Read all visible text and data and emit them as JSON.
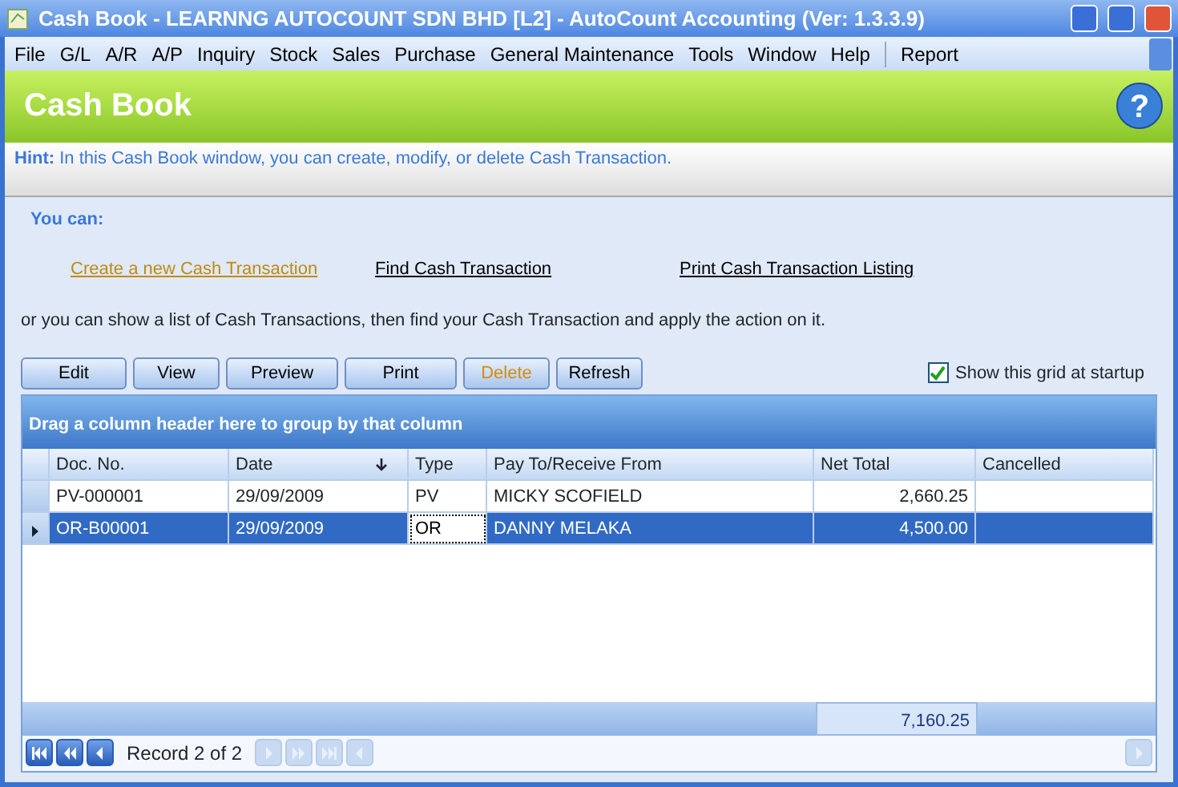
{
  "window": {
    "title": "Cash Book - LEARNNG AUTOCOUNT SDN BHD [L2] - AutoCount Accounting (Ver: 1.3.3.9)"
  },
  "menu": [
    "File",
    "G/L",
    "A/R",
    "A/P",
    "Inquiry",
    "Stock",
    "Sales",
    "Purchase",
    "General Maintenance",
    "Tools",
    "Window",
    "Help",
    "Report"
  ],
  "header": {
    "title": "Cash Book",
    "help_glyph": "?"
  },
  "hint": {
    "label": "Hint:",
    "text": "In this Cash Book window, you can create, modify, or delete Cash Transaction."
  },
  "you_can": "You can:",
  "links": [
    {
      "label": "Create a new Cash Transaction",
      "highlighted": true
    },
    {
      "label": "Find Cash Transaction",
      "highlighted": false
    },
    {
      "label": "Print Cash Transaction Listing",
      "highlighted": false
    }
  ],
  "instruction": "or you can show a list of Cash Transactions, then find your Cash Transaction and apply the action on it.",
  "buttons": [
    {
      "label": "Edit",
      "highlighted": false
    },
    {
      "label": "View",
      "highlighted": false
    },
    {
      "label": "Preview",
      "highlighted": false
    },
    {
      "label": "Print",
      "highlighted": false
    },
    {
      "label": "Delete",
      "highlighted": true
    },
    {
      "label": "Refresh",
      "highlighted": false
    }
  ],
  "show_grid_checkbox": {
    "label": "Show this grid at startup",
    "checked": true
  },
  "grid": {
    "group_panel": "Drag a column header here to group by that column",
    "columns": [
      {
        "label": "Doc. No.",
        "sorted": false
      },
      {
        "label": "Date",
        "sorted": true
      },
      {
        "label": "Type",
        "sorted": false
      },
      {
        "label": "Pay To/Receive From",
        "sorted": false
      },
      {
        "label": "Net Total",
        "sorted": false
      },
      {
        "label": "Cancelled",
        "sorted": false
      }
    ],
    "rows": [
      {
        "cells": [
          "PV-000001",
          "29/09/2009",
          "PV",
          "MICKY SCOFIELD",
          "2,660.25",
          ""
        ],
        "selected": false
      },
      {
        "cells": [
          "OR-B00001",
          "29/09/2009",
          "OR",
          "DANNY MELAKA",
          "4,500.00",
          ""
        ],
        "selected": true
      }
    ],
    "footer_total": "7,160.25",
    "record_label": "Record 2 of 2"
  }
}
